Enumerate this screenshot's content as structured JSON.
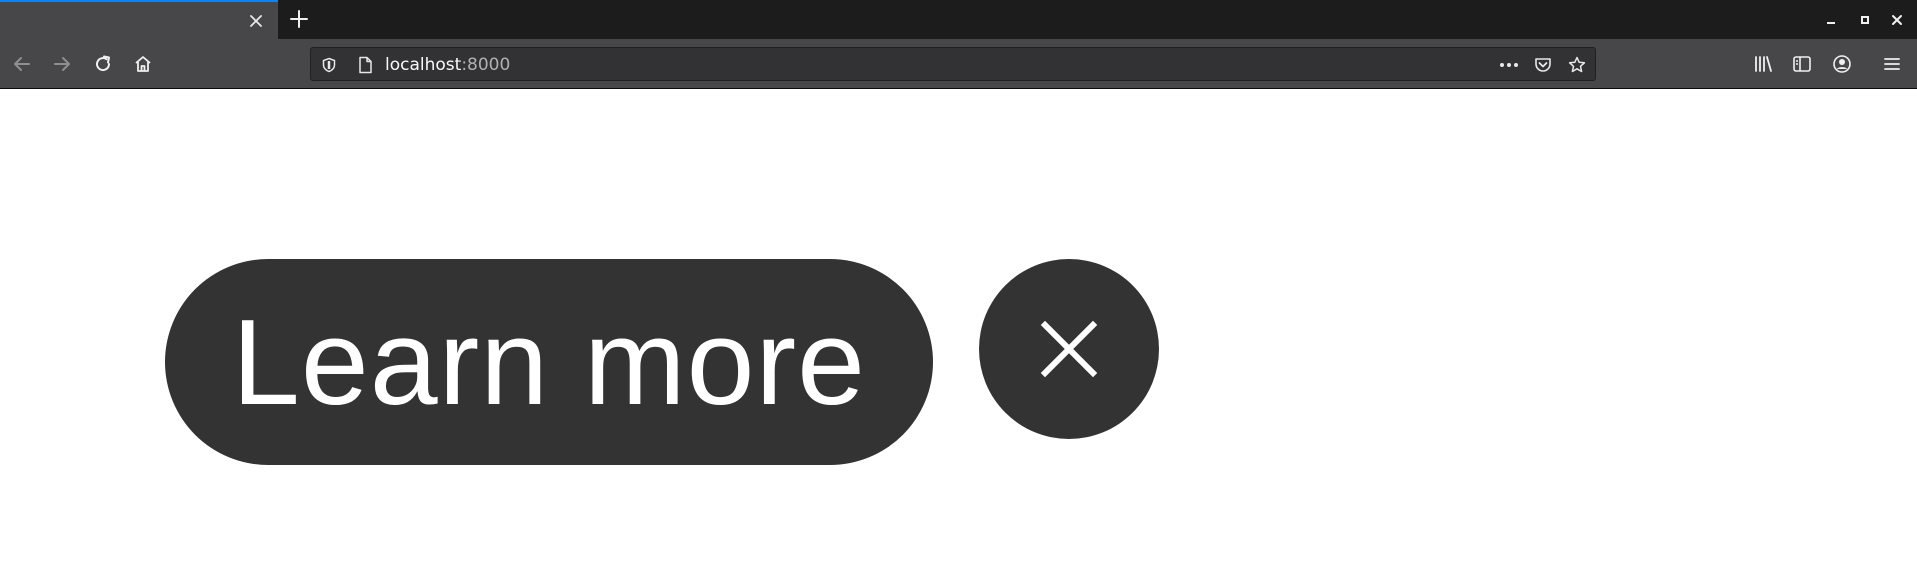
{
  "browser": {
    "tab": {
      "close_icon": "close-icon"
    },
    "new_tab_icon": "plus-icon",
    "window_controls": [
      "minimize-icon",
      "maximize-icon",
      "close-icon"
    ],
    "toolbar": {
      "back_icon": "arrow-left-icon",
      "forward_icon": "arrow-right-icon",
      "reload_icon": "reload-icon",
      "home_icon": "home-icon",
      "right_icons": [
        "library-icon",
        "sidebar-icon",
        "account-icon",
        "menu-icon"
      ]
    },
    "urlbar": {
      "host": "localhost",
      "port": ":8000",
      "left_icons": [
        "shield-icon",
        "page-icon"
      ],
      "right_icons": [
        "more-icon",
        "pocket-icon",
        "star-icon"
      ]
    }
  },
  "page": {
    "learn_more_label": "Learn more",
    "close_button_icon": "close-icon"
  },
  "colors": {
    "tabstrip": "#1c1c1c",
    "toolbar": "#474749",
    "urlbar": "#323234",
    "button_bg": "#333333",
    "button_text": "#ffffff",
    "accent": "#0a84ff"
  }
}
